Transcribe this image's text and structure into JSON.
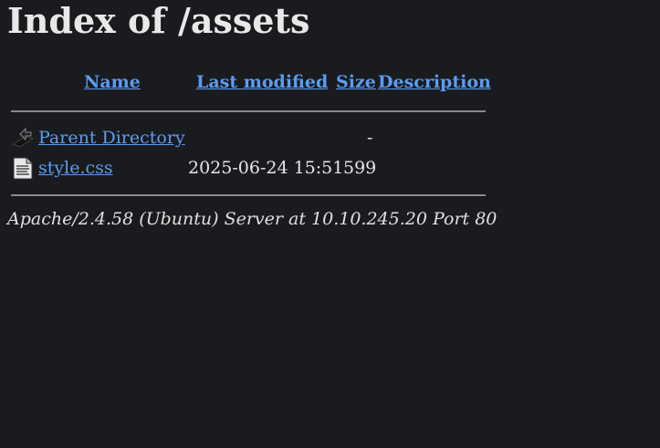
{
  "page": {
    "title": "Index of /assets"
  },
  "table": {
    "headers": {
      "name": "Name",
      "last_modified": "Last modified",
      "size": "Size",
      "description": "Description"
    },
    "rows": [
      {
        "icon": "parent-directory-icon",
        "name": "Parent Directory",
        "last_modified": "",
        "size": "-"
      },
      {
        "icon": "text-file-icon",
        "name": "style.css",
        "last_modified": "2025-06-24 15:51",
        "size": "599"
      }
    ]
  },
  "footer": {
    "server_signature": "Apache/2.4.58 (Ubuntu) Server at 10.10.245.20 Port 80"
  }
}
